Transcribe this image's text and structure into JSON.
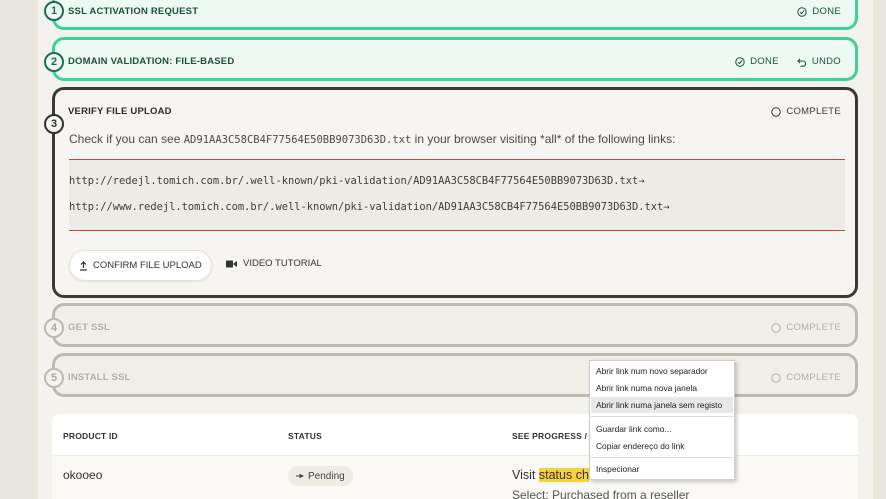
{
  "steps": [
    {
      "num": "1",
      "title": "SSL ACTIVATION REQUEST",
      "actions": [
        "DONE"
      ]
    },
    {
      "num": "2",
      "title": "DOMAIN VALIDATION: FILE-BASED",
      "actions": [
        "DONE",
        "UNDO"
      ]
    },
    {
      "num": "3",
      "title": "VERIFY FILE UPLOAD",
      "actions": [
        "COMPLETE"
      ]
    },
    {
      "num": "4",
      "title": "GET SSL",
      "actions": [
        "COMPLETE"
      ]
    },
    {
      "num": "5",
      "title": "INSTALL SSL",
      "actions": [
        "COMPLETE"
      ]
    }
  ],
  "verify": {
    "check_prefix": "Check if you can see ",
    "filename": "AD91AA3C58CB4F77564E50BB9073D63D.txt",
    "check_suffix": " in your browser visiting *all* of the following links:",
    "links": [
      "http://redejl.tomich.com.br/.well-known/pki-validation/AD91AA3C58CB4F77564E50BB9073D63D.txt",
      "http://www.redejl.tomich.com.br/.well-known/pki-validation/AD91AA3C58CB4F77564E50BB9073D63D.txt"
    ],
    "link_arrow": "→",
    "confirm_label": "CONFIRM FILE UPLOAD",
    "video_label": "VIDEO TUTORIAL"
  },
  "table": {
    "headers": [
      "PRODUCT ID",
      "STATUS",
      "SEE PROGRESS / CH"
    ],
    "row": {
      "product_id": "okooeo",
      "status": "Pending",
      "visit_prefix": "Visit ",
      "visit_link": "status ch",
      "select_text": "Select: Purchased from a reseller"
    }
  },
  "context_menu": {
    "items": [
      "Abrir link num novo separador",
      "Abrir link numa nova janela",
      "Abrir link numa janela sem registo",
      "Guardar link como...",
      "Copiar endereço do link",
      "Inspecionar"
    ]
  },
  "colors": {
    "done_border": "#3fd09b",
    "active_border": "#3a3a38",
    "inactive_border": "#bdbab0",
    "link_rule": "#c9453f",
    "highlight": "#f6d33a"
  }
}
